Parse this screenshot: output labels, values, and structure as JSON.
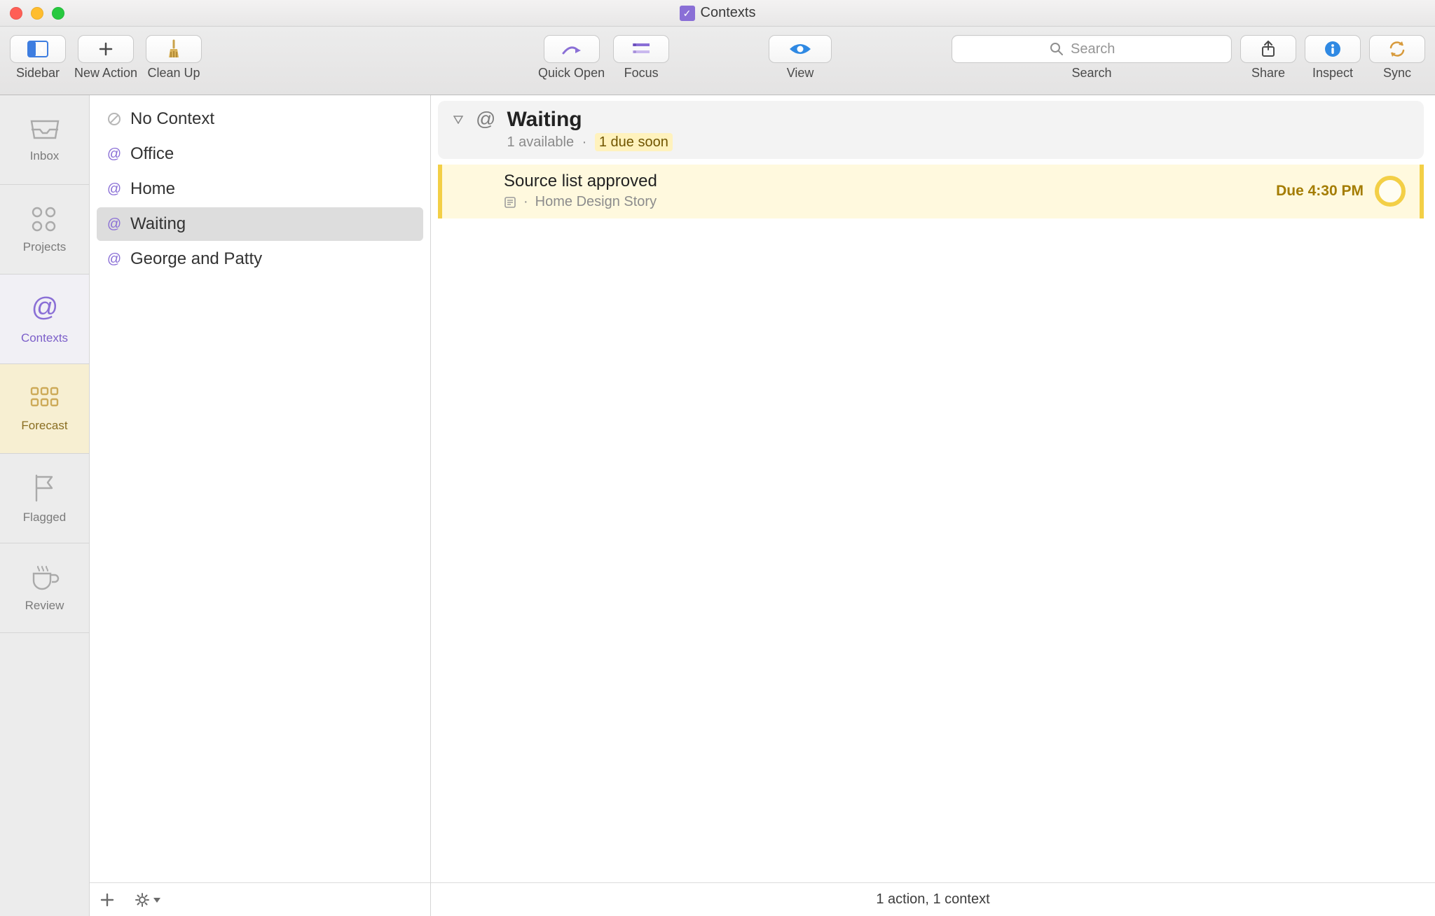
{
  "window": {
    "title": "Contexts"
  },
  "toolbar": {
    "sidebar": "Sidebar",
    "new_action": "New Action",
    "clean_up": "Clean Up",
    "quick_open": "Quick Open",
    "focus": "Focus",
    "view": "View",
    "search_placeholder": "Search",
    "search_label": "Search",
    "share": "Share",
    "inspect": "Inspect",
    "sync": "Sync"
  },
  "perspectives": [
    {
      "id": "inbox",
      "label": "Inbox"
    },
    {
      "id": "projects",
      "label": "Projects"
    },
    {
      "id": "contexts",
      "label": "Contexts"
    },
    {
      "id": "forecast",
      "label": "Forecast"
    },
    {
      "id": "flagged",
      "label": "Flagged"
    },
    {
      "id": "review",
      "label": "Review"
    }
  ],
  "contexts": [
    {
      "label": "No Context"
    },
    {
      "label": "Office"
    },
    {
      "label": "Home"
    },
    {
      "label": "Waiting"
    },
    {
      "label": "George and Patty"
    }
  ],
  "selected_context_index": 3,
  "section": {
    "title": "Waiting",
    "available_text": "1 available",
    "due_soon_text": "1 due soon"
  },
  "tasks": [
    {
      "title": "Source list approved",
      "project": "Home Design Story",
      "due_label": "Due 4:30 PM"
    }
  ],
  "status_bar": "1 action, 1 context"
}
